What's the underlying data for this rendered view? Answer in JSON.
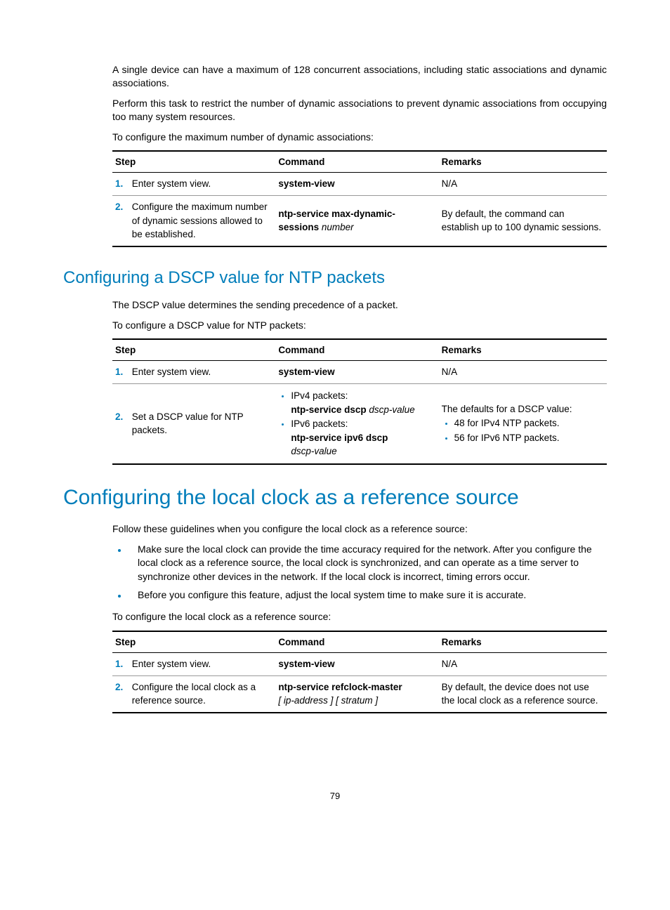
{
  "intro": {
    "p1": "A single device can have a maximum of 128 concurrent associations, including static associations and dynamic associations.",
    "p2": "Perform this task to restrict the number of dynamic associations to prevent dynamic associations from occupying too many system resources.",
    "p3": "To configure the maximum number of dynamic associations:"
  },
  "table_headers": {
    "step": "Step",
    "command": "Command",
    "remarks": "Remarks"
  },
  "table1": {
    "r1": {
      "num": "1.",
      "step": "Enter system view.",
      "cmd": "system-view",
      "rem": "N/A"
    },
    "r2": {
      "num": "2.",
      "step": "Configure the maximum number of dynamic sessions allowed to be established.",
      "cmd_bold": "ntp-service max-dynamic-sessions",
      "cmd_ital": "number",
      "rem": "By default, the command can establish up to 100 dynamic sessions."
    }
  },
  "section2": {
    "heading": "Configuring a DSCP value for NTP packets",
    "p1": "The DSCP value determines the sending precedence of a packet.",
    "p2": "To configure a DSCP value for NTP packets:"
  },
  "table2": {
    "r1": {
      "num": "1.",
      "step": "Enter system view.",
      "cmd": "system-view",
      "rem": "N/A"
    },
    "r2": {
      "num": "2.",
      "step": "Set a DSCP value for NTP packets.",
      "b1_label": "IPv4 packets:",
      "b1_cmd_bold": "ntp-service dscp",
      "b1_cmd_ital": "dscp-value",
      "b2_label": "IPv6 packets:",
      "b2_cmd_bold": "ntp-service ipv6 dscp",
      "b2_cmd_ital": "dscp-value",
      "rem_lead": "The defaults for a DSCP value:",
      "rem_b1": "48 for IPv4 NTP packets.",
      "rem_b2": "56 for IPv6 NTP packets."
    }
  },
  "section3": {
    "heading": "Configuring the local clock as a reference source",
    "p1": "Follow these guidelines when you configure the local clock as a reference source:",
    "b1": "Make sure the local clock can provide the time accuracy required for the network. After you configure the local clock as a reference source, the local clock is synchronized, and can operate as a time server to synchronize other devices in the network. If the local clock is incorrect, timing errors occur.",
    "b2": "Before you configure this feature, adjust the local system time to make sure it is accurate.",
    "p2": "To configure the local clock as a reference source:"
  },
  "table3": {
    "r1": {
      "num": "1.",
      "step": "Enter system view.",
      "cmd": "system-view",
      "rem": "N/A"
    },
    "r2": {
      "num": "2.",
      "step": "Configure the local clock as a reference source.",
      "cmd_bold": "ntp-service refclock-master",
      "cmd_ital": "[ ip-address ] [ stratum ]",
      "rem": "By default, the device does not use the local clock as a reference source."
    }
  },
  "page_number": "79"
}
